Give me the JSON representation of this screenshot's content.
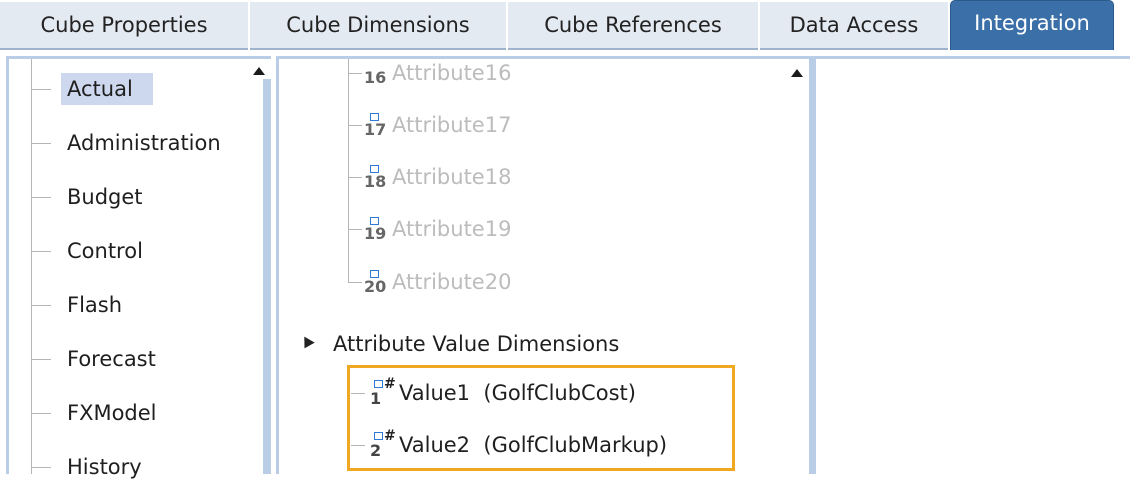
{
  "tabs": [
    {
      "label": "Cube Properties",
      "active": false
    },
    {
      "label": "Cube Dimensions",
      "active": false
    },
    {
      "label": "Cube References",
      "active": false
    },
    {
      "label": "Data Access",
      "active": false
    },
    {
      "label": "Integration",
      "active": true
    }
  ],
  "cubes": {
    "selected": "Actual",
    "items": [
      "Actual",
      "Administration",
      "Budget",
      "Control",
      "Flash",
      "Forecast",
      "FXModel",
      "History"
    ]
  },
  "attributes": [
    {
      "num": "16",
      "label": "Attribute16"
    },
    {
      "num": "17",
      "label": "Attribute17"
    },
    {
      "num": "18",
      "label": "Attribute18"
    },
    {
      "num": "19",
      "label": "Attribute19"
    },
    {
      "num": "20",
      "label": "Attribute20"
    }
  ],
  "attribute_value_dimensions": {
    "label": "Attribute Value Dimensions",
    "items": [
      {
        "num": "1",
        "label": "Value1  (GolfClubCost)"
      },
      {
        "num": "2",
        "label": "Value2  (GolfClubMarkup)"
      }
    ]
  },
  "colors": {
    "active_tab": "#3a6fa8",
    "inactive_tab": "#e4eaf2",
    "selection": "#cdd8ee",
    "highlight_border": "#f0a822",
    "panel_border": "#b9cde6",
    "icon_blue": "#2f7ad6",
    "disabled_text": "#bcbcbc"
  }
}
